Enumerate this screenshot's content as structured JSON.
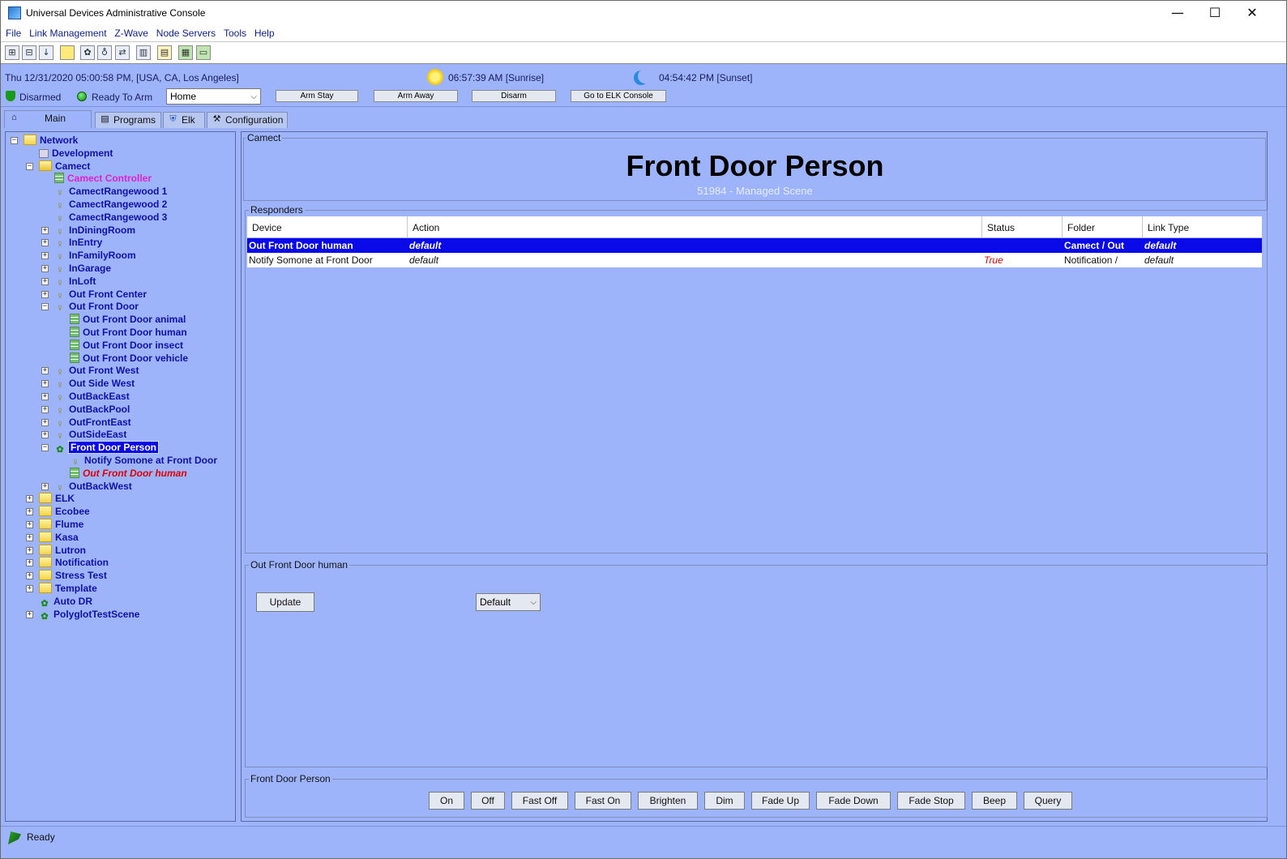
{
  "window": {
    "title": "Universal Devices Administrative Console",
    "controls": {
      "minimize": "—",
      "maximize": "☐",
      "close": "✕"
    }
  },
  "menu": [
    "File",
    "Link Management",
    "Z-Wave",
    "Node Servers",
    "Tools",
    "Help"
  ],
  "toolbar": {
    "icons": [
      "expand-all-icon",
      "collapse-all-icon",
      "sort-icon",
      "notes-icon",
      "scenes-icon",
      "bulb-icon",
      "link-icon",
      "chart-icon",
      "log-icon",
      "controller-icon",
      "battery-icon"
    ]
  },
  "info": {
    "datetime": "Thu 12/31/2020 05:00:58 PM,  [USA, CA, Los Angeles]",
    "sunrise": "06:57:39 AM [Sunrise]",
    "sunset": "04:54:42 PM [Sunset]",
    "alarm_status": "Disarmed",
    "ready_status": "Ready To Arm",
    "area_select": "Home",
    "buttons": [
      "Arm Stay",
      "Arm Away",
      "Disarm",
      "Go to ELK Console"
    ]
  },
  "tabs": [
    "Main",
    "Programs",
    "Elk",
    "Configuration"
  ],
  "tree": [
    {
      "label": "Network",
      "depth": 0,
      "icon": "folder",
      "exp": "-"
    },
    {
      "label": "Development",
      "depth": 1,
      "icon": "dev",
      "exp": ""
    },
    {
      "label": "Camect",
      "depth": 1,
      "icon": "openfolder",
      "exp": "-"
    },
    {
      "label": "Camect Controller",
      "depth": 2,
      "icon": "grid",
      "exp": "",
      "style": "magenta"
    },
    {
      "label": "CamectRangewood 1",
      "depth": 2,
      "icon": "bulb",
      "exp": ""
    },
    {
      "label": "CamectRangewood 2",
      "depth": 2,
      "icon": "bulb",
      "exp": ""
    },
    {
      "label": "CamectRangewood 3",
      "depth": 2,
      "icon": "bulb",
      "exp": ""
    },
    {
      "label": "InDiningRoom",
      "depth": 2,
      "icon": "bulb",
      "exp": "+"
    },
    {
      "label": "InEntry",
      "depth": 2,
      "icon": "bulb",
      "exp": "+"
    },
    {
      "label": "InFamilyRoom",
      "depth": 2,
      "icon": "bulb",
      "exp": "+"
    },
    {
      "label": "InGarage",
      "depth": 2,
      "icon": "bulb",
      "exp": "+"
    },
    {
      "label": "InLoft",
      "depth": 2,
      "icon": "bulb",
      "exp": "+"
    },
    {
      "label": "Out Front Center",
      "depth": 2,
      "icon": "bulb",
      "exp": "+"
    },
    {
      "label": "Out Front Door",
      "depth": 2,
      "icon": "bulb",
      "exp": "-"
    },
    {
      "label": "Out Front Door animal",
      "depth": 3,
      "icon": "grid",
      "exp": ""
    },
    {
      "label": "Out Front Door human",
      "depth": 3,
      "icon": "grid",
      "exp": ""
    },
    {
      "label": "Out Front Door insect",
      "depth": 3,
      "icon": "grid",
      "exp": ""
    },
    {
      "label": "Out Front Door vehicle",
      "depth": 3,
      "icon": "grid",
      "exp": ""
    },
    {
      "label": "Out Front West",
      "depth": 2,
      "icon": "bulb",
      "exp": "+"
    },
    {
      "label": "Out Side West",
      "depth": 2,
      "icon": "bulb",
      "exp": "+"
    },
    {
      "label": "OutBackEast",
      "depth": 2,
      "icon": "bulb",
      "exp": "+"
    },
    {
      "label": "OutBackPool",
      "depth": 2,
      "icon": "bulb",
      "exp": "+"
    },
    {
      "label": "OutFrontEast",
      "depth": 2,
      "icon": "bulb",
      "exp": "+"
    },
    {
      "label": "OutSideEast",
      "depth": 2,
      "icon": "bulb",
      "exp": "+"
    },
    {
      "label": "Front Door Person",
      "depth": 2,
      "icon": "scene",
      "exp": "-",
      "style": "selected"
    },
    {
      "label": "Notify Somone at Front Door",
      "depth": 3,
      "icon": "bulb",
      "exp": ""
    },
    {
      "label": "Out Front Door human",
      "depth": 3,
      "icon": "grid",
      "exp": "",
      "style": "red"
    },
    {
      "label": "OutBackWest",
      "depth": 2,
      "icon": "bulb",
      "exp": "+"
    },
    {
      "label": "ELK",
      "depth": 1,
      "icon": "folder",
      "exp": "+"
    },
    {
      "label": "Ecobee",
      "depth": 1,
      "icon": "folder",
      "exp": "+"
    },
    {
      "label": "Flume",
      "depth": 1,
      "icon": "folder",
      "exp": "+"
    },
    {
      "label": "Kasa",
      "depth": 1,
      "icon": "folder",
      "exp": "+"
    },
    {
      "label": "Lutron",
      "depth": 1,
      "icon": "folder",
      "exp": "+"
    },
    {
      "label": "Notification",
      "depth": 1,
      "icon": "folder",
      "exp": "+"
    },
    {
      "label": "Stress Test",
      "depth": 1,
      "icon": "folder",
      "exp": "+"
    },
    {
      "label": "Template",
      "depth": 1,
      "icon": "folder",
      "exp": "+"
    },
    {
      "label": "Auto DR",
      "depth": 1,
      "icon": "scene",
      "exp": ""
    },
    {
      "label": "PolyglotTestScene",
      "depth": 1,
      "icon": "scene",
      "exp": "+"
    }
  ],
  "main": {
    "group_label": "Camect",
    "scene_title": "Front Door Person",
    "scene_subtitle": "51984 - Managed Scene",
    "responders_label": "Responders",
    "columns": [
      "Device",
      "Action",
      "Status",
      "Folder",
      "Link Type"
    ],
    "rows": [
      {
        "device": "Out Front Door human",
        "action": "default",
        "status": "",
        "folder": "Camect / Out",
        "link_type": "default",
        "selected": true
      },
      {
        "device": "Notify Somone at Front Door",
        "action": "default",
        "status": "True",
        "folder": "Notification /",
        "link_type": "default",
        "selected": false
      }
    ],
    "detail_label": "Out Front Door human",
    "update_button": "Update",
    "detail_select": "Default",
    "control_label": "Front Door Person",
    "control_buttons": [
      "On",
      "Off",
      "Fast Off",
      "Fast On",
      "Brighten",
      "Dim",
      "Fade Up",
      "Fade Down",
      "Fade Stop",
      "Beep",
      "Query"
    ]
  },
  "status": {
    "text": "Ready"
  },
  "colors": {
    "panel": "#9db4fb",
    "tree_text": "#1010a8",
    "selection": "#0a0ae8",
    "status_true": "#e00000"
  }
}
